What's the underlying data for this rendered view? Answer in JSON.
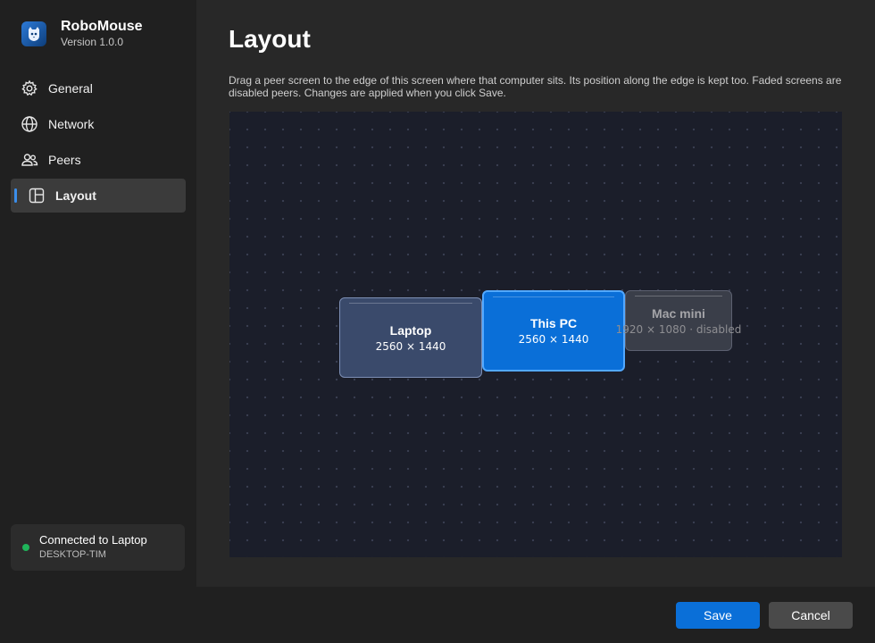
{
  "app": {
    "name": "RoboMouse",
    "version": "Version 1.0.0",
    "logo_icon": "mouse-logo-icon"
  },
  "sidebar": {
    "items": [
      {
        "label": "General",
        "icon": "gear-icon",
        "active": false
      },
      {
        "label": "Network",
        "icon": "globe-icon",
        "active": false
      },
      {
        "label": "Peers",
        "icon": "people-icon",
        "active": false
      },
      {
        "label": "Layout",
        "icon": "layout-icon",
        "active": true
      }
    ],
    "status": {
      "title": "Connected to Laptop",
      "subtitle": "DESKTOP-TIM",
      "color": "#1fb45a"
    }
  },
  "main": {
    "title": "Layout",
    "description": "Drag a peer screen to the edge of this screen where that computer sits. Its position along the edge is kept too. Faded screens are disabled peers. Changes are applied when you click Save.",
    "screens": [
      {
        "name": "Laptop",
        "resolution": "2560 × 1440",
        "role": "peer"
      },
      {
        "name": "This PC",
        "resolution": "2560 × 1440",
        "role": "local"
      },
      {
        "name": "Mac mini",
        "resolution": "1920 × 1080  ·  disabled",
        "role": "disabled"
      }
    ]
  },
  "footer": {
    "save_label": "Save",
    "cancel_label": "Cancel"
  },
  "colors": {
    "accent": "#0a6fd8",
    "canvas": "#1b1e2a",
    "sidebar": "#202020"
  }
}
